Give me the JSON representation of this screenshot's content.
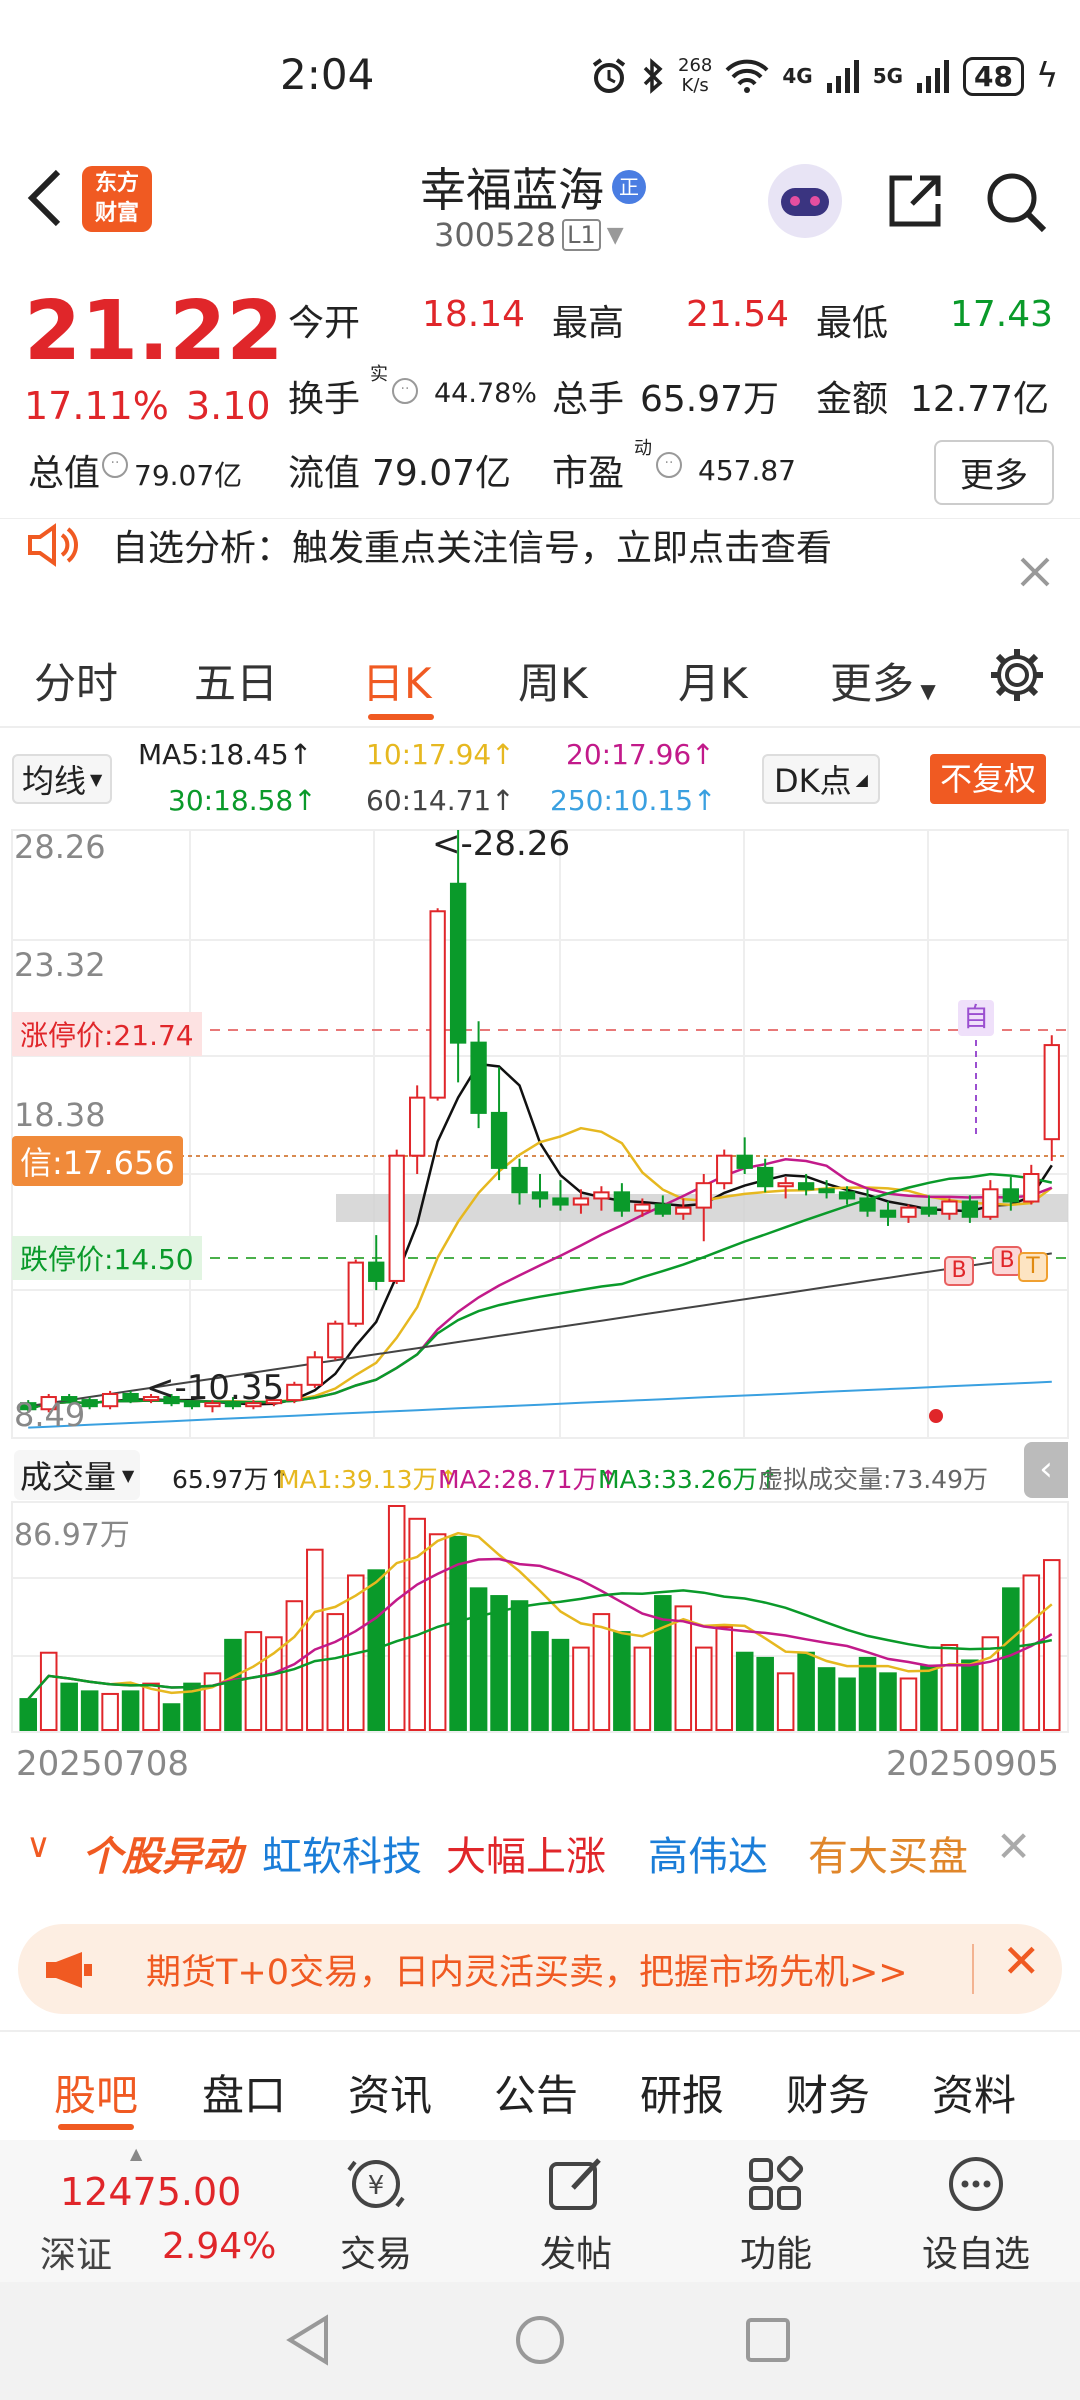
{
  "status": {
    "time": "2:04",
    "speed_top": "268",
    "speed_bottom": "K/s",
    "net1": "4G",
    "net2": "5G",
    "battery": "48"
  },
  "header": {
    "title": "幸福蓝海",
    "badge": "正",
    "code": "300528",
    "level": "L1",
    "logo_line1": "东方",
    "logo_line2": "财富"
  },
  "quote": {
    "price": "21.22",
    "pct": "17.11%",
    "chg": "3.10",
    "open_label": "今开",
    "open": "18.14",
    "high_label": "最高",
    "high": "21.54",
    "low_label": "最低",
    "low": "17.43",
    "turnover_label": "换手",
    "turnover_sup": "实",
    "turnover": "44.78%",
    "vol_label": "总手",
    "vol": "65.97万",
    "amount_label": "金额",
    "amount": "12.77亿",
    "mcap_label": "总值",
    "mcap": "79.07亿",
    "float_label": "流值",
    "float": "79.07亿",
    "pe_label": "市盈",
    "pe_sup": "动",
    "pe": "457.87",
    "more": "更多"
  },
  "notice": {
    "text": "自选分析：触发重点关注信号，立即点击查看"
  },
  "tabs": [
    "分时",
    "五日",
    "日K",
    "周K",
    "月K",
    "更多"
  ],
  "ma_bar": {
    "select": "均线",
    "ma5": "MA5:18.45↑",
    "ma10": "10:17.94↑",
    "ma20": "20:17.96↑",
    "ma30": "30:18.58↑",
    "ma60": "60:14.71↑",
    "ma250": "250:10.15↑",
    "dk": "DK点",
    "fq": "不复权"
  },
  "kline": {
    "ticks": [
      "28.26",
      "23.32",
      "18.38",
      "13.44",
      "8.49"
    ],
    "max_label": "<-28.26",
    "min_label": "<-10.35",
    "limit_up": "涨停价:21.74",
    "limit_down": "跌停价:14.50",
    "signal": "信:17.656",
    "self_mark": "自",
    "markers": [
      "B",
      "B",
      "T"
    ]
  },
  "volume_bar": {
    "select": "成交量",
    "vol": "65.97万↑",
    "ma1": "MA1:39.13万↑",
    "ma2": "MA2:28.71万↑",
    "ma3": "MA3:33.26万↑",
    "virtual": "虚拟成交量:73.49万",
    "max": "86.97万"
  },
  "dates": {
    "start": "20250708",
    "end": "20250905"
  },
  "movers": {
    "title": "个股异动",
    "name1": "虹软科技",
    "tag1": "大幅上涨",
    "name2": "高伟达",
    "tag2": "有大买盘"
  },
  "promo": {
    "text": "期货T+0交易，日内灵活买卖，把握市场先机>>"
  },
  "subtabs": [
    "股吧",
    "盘口",
    "资讯",
    "公告",
    "研报",
    "财务",
    "资料"
  ],
  "bottom": {
    "index_value": "12475.00",
    "index_name": "深证",
    "index_pct": "2.94%",
    "trade": "交易",
    "post": "发帖",
    "func": "功能",
    "watch": "设自选"
  },
  "chart_data": [
    {
      "type": "candlestick",
      "title": "日K",
      "x_range": [
        "20250708",
        "20250905"
      ],
      "ylim": [
        8.49,
        28.26
      ],
      "yticks": [
        28.26,
        23.32,
        18.38,
        13.44,
        8.49
      ],
      "series": [
        {
          "name": "K",
          "candles": [
            [
              9.5,
              9.6,
              9.2,
              9.3
            ],
            [
              9.3,
              9.8,
              9.2,
              9.7
            ],
            [
              9.7,
              9.8,
              9.5,
              9.6
            ],
            [
              9.6,
              9.7,
              9.3,
              9.4
            ],
            [
              9.4,
              9.9,
              9.3,
              9.8
            ],
            [
              9.8,
              9.9,
              9.5,
              9.6
            ],
            [
              9.6,
              9.8,
              9.5,
              9.7
            ],
            [
              9.7,
              9.8,
              9.4,
              9.5
            ],
            [
              9.5,
              9.6,
              9.3,
              9.4
            ],
            [
              9.4,
              9.6,
              9.2,
              9.5
            ],
            [
              9.5,
              9.7,
              9.3,
              9.4
            ],
            [
              9.4,
              9.6,
              9.3,
              9.5
            ],
            [
              9.5,
              9.7,
              9.4,
              9.6
            ],
            [
              9.6,
              10.2,
              9.5,
              10.1
            ],
            [
              10.1,
              11.2,
              10.0,
              11.0
            ],
            [
              11.0,
              12.2,
              10.9,
              12.1
            ],
            [
              12.1,
              14.2,
              12.0,
              14.1
            ],
            [
              14.1,
              15.0,
              13.2,
              13.5
            ],
            [
              13.5,
              17.8,
              13.4,
              17.6
            ],
            [
              17.6,
              19.9,
              17.0,
              19.5
            ],
            [
              19.5,
              25.7,
              19.4,
              25.6
            ],
            [
              26.5,
              28.26,
              20.0,
              21.3
            ],
            [
              21.3,
              22.0,
              18.5,
              19.0
            ],
            [
              19.0,
              20.5,
              16.8,
              17.2
            ],
            [
              17.2,
              17.5,
              16.0,
              16.4
            ],
            [
              16.4,
              17.0,
              15.9,
              16.2
            ],
            [
              16.2,
              16.8,
              15.8,
              16.0
            ],
            [
              16.0,
              16.5,
              15.7,
              16.2
            ],
            [
              16.2,
              16.6,
              15.8,
              16.4
            ],
            [
              16.4,
              16.7,
              15.6,
              15.8
            ],
            [
              15.8,
              16.2,
              15.6,
              16.0
            ],
            [
              16.0,
              16.3,
              15.6,
              15.7
            ],
            [
              15.7,
              16.2,
              15.5,
              15.9
            ],
            [
              15.9,
              17.0,
              14.8,
              16.7
            ],
            [
              16.7,
              17.8,
              16.5,
              17.6
            ],
            [
              17.6,
              18.2,
              17.0,
              17.2
            ],
            [
              17.2,
              17.5,
              16.4,
              16.6
            ],
            [
              16.6,
              16.9,
              16.2,
              16.7
            ],
            [
              16.7,
              17.0,
              16.3,
              16.5
            ],
            [
              16.5,
              16.8,
              16.2,
              16.4
            ],
            [
              16.4,
              16.6,
              16.0,
              16.2
            ],
            [
              16.2,
              16.5,
              15.6,
              15.8
            ],
            [
              15.8,
              16.1,
              15.3,
              15.6
            ],
            [
              15.6,
              16.0,
              15.4,
              15.9
            ],
            [
              15.9,
              16.3,
              15.6,
              15.7
            ],
            [
              15.7,
              16.2,
              15.5,
              16.1
            ],
            [
              16.1,
              16.3,
              15.4,
              15.6
            ],
            [
              15.6,
              16.8,
              15.5,
              16.5
            ],
            [
              16.5,
              16.9,
              15.8,
              16.1
            ],
            [
              16.1,
              17.3,
              16.0,
              17.0
            ],
            [
              18.14,
              21.54,
              17.43,
              21.22
            ]
          ]
        }
      ],
      "ma_lines": [
        "MA5",
        "MA10",
        "MA20",
        "MA30",
        "MA60",
        "MA250"
      ]
    },
    {
      "type": "bar",
      "title": "成交量",
      "ylim": [
        0,
        86.97
      ],
      "ylabel": "万",
      "values": [
        12,
        30,
        18,
        15,
        14,
        15,
        18,
        10,
        18,
        22,
        35,
        38,
        36,
        50,
        70,
        45,
        60,
        62,
        86.97,
        82,
        76,
        75,
        55,
        52,
        50,
        38,
        35,
        32,
        45,
        38,
        32,
        52,
        48,
        32,
        40,
        30,
        28,
        22,
        30,
        24,
        20,
        28,
        22,
        20,
        25,
        33,
        27,
        36,
        55,
        60,
        65.97
      ]
    }
  ]
}
